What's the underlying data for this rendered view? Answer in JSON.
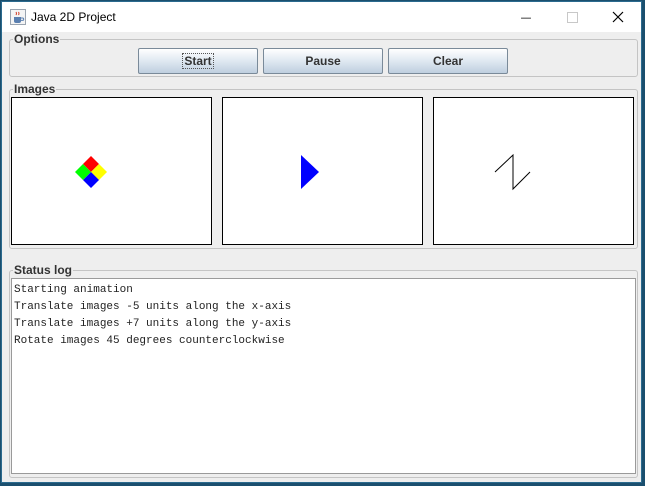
{
  "window": {
    "title": "Java 2D Project",
    "icon": "java-coffee-cup-icon",
    "controls": {
      "minimize": "—",
      "maximize": "☐",
      "close": "✕"
    }
  },
  "options": {
    "title": "Options",
    "buttons": {
      "start": "Start",
      "pause": "Pause",
      "clear": "Clear"
    },
    "focused_button": "Start"
  },
  "images": {
    "title": "Images",
    "panels": [
      {
        "shape": "four-colored-diamond",
        "colors": [
          "#ff0000",
          "#ffff00",
          "#0000ff",
          "#00ff00"
        ]
      },
      {
        "shape": "right-pointing-triangle",
        "colors": [
          "#0000ff"
        ]
      },
      {
        "shape": "z-shaped-polyline",
        "colors": [
          "#000000"
        ]
      }
    ]
  },
  "status_log": {
    "title": "Status log",
    "lines": [
      "Starting animation",
      "Translate images -5 units along the x-axis",
      "Translate images +7 units along the y-axis",
      "Rotate images 45 degrees counterclockwise"
    ]
  }
}
